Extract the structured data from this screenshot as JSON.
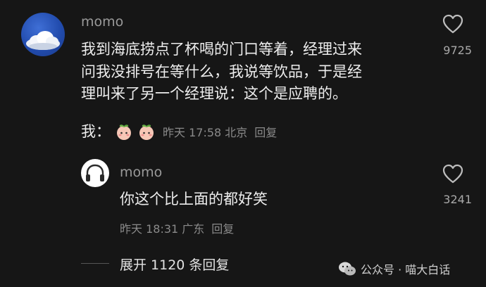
{
  "main_comment": {
    "username": "momo",
    "text_lines": [
      "我到海底捞点了杯喝的门口等着，经理过来",
      "问我没排号在等什么，我说等饮品，于是经",
      "理叫来了另一个经理说：这个是应聘的。"
    ],
    "sub_prefix": "我：",
    "timestamp": "昨天 17:58 北京",
    "reply_label": "回复",
    "like_count": "9725",
    "avatar_icon": "cloud-avatar-icon"
  },
  "reply_comment": {
    "username": "momo",
    "text": "你这个比上面的都好笑",
    "timestamp": "昨天 18:31 广东",
    "reply_label": "回复",
    "like_count": "3241",
    "avatar_icon": "headphones-avatar-icon"
  },
  "expand": {
    "label": "展开 1120 条回复"
  },
  "watermark": {
    "text": "公众号 · 喵大白话",
    "icon": "wechat-icon"
  },
  "colors": {
    "background": "#161616",
    "text": "#ededed",
    "muted": "#8a8a8a"
  }
}
